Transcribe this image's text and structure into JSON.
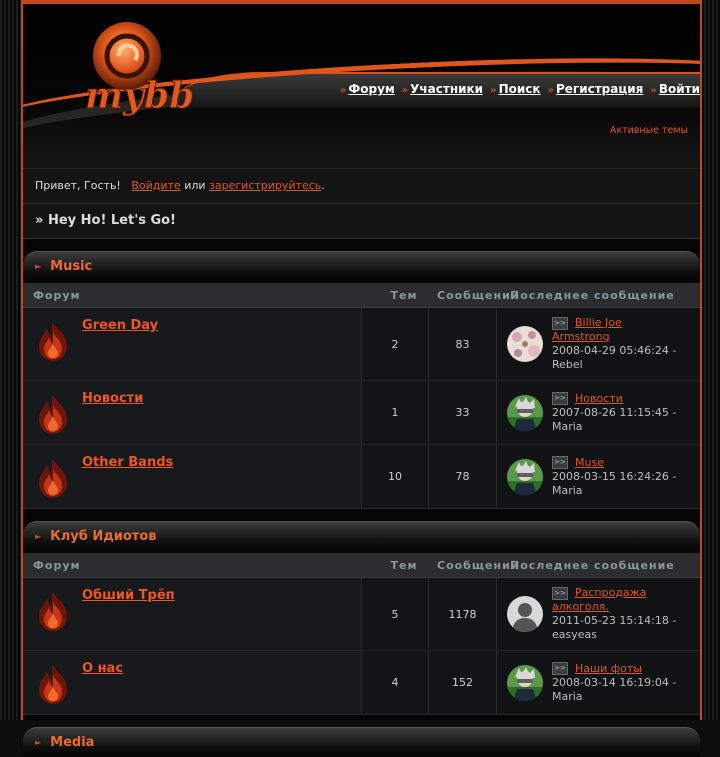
{
  "header": {
    "nav": [
      {
        "label": "Форум",
        "icon": "arrow-icon"
      },
      {
        "label": "Участники",
        "icon": "arrow-icon"
      },
      {
        "label": "Поиск",
        "icon": "arrow-icon"
      },
      {
        "label": "Регистрация",
        "icon": "arrow-icon"
      },
      {
        "label": "Войти",
        "icon": "arrow-icon"
      }
    ],
    "active_topics": "Активные темы",
    "logo_text": "mybb"
  },
  "welcome": {
    "prefix": "Привет, Гость!",
    "login": "Войдите",
    "or": "или",
    "register": "зарегистрируйтесь",
    "end": "."
  },
  "breadcrumb": {
    "sep": "»",
    "title": "Hey Ho! Let's Go!"
  },
  "columns": {
    "forum": "Форум",
    "threads": "Тем",
    "posts": "Сообщений",
    "last": "Последнее сообщение"
  },
  "categories": [
    {
      "name": "Music",
      "forums": [
        {
          "name": "Green Day",
          "threads": "2",
          "posts": "83",
          "last_title": "Billie Joe Armstrong",
          "last_date": "2008-04-29 05:46:24 -",
          "last_user": "Rebel",
          "avatar": "floral"
        },
        {
          "name": "Новости",
          "threads": "1",
          "posts": "33",
          "last_title": "Новости",
          "last_date": "2007-08-26 11:15:45 -",
          "last_user": "Maria",
          "avatar": "ninja"
        },
        {
          "name": "Other Bands",
          "threads": "10",
          "posts": "78",
          "last_title": "Muse",
          "last_date": "2008-03-15 16:24:26 -",
          "last_user": "Maria",
          "avatar": "ninja"
        }
      ]
    },
    {
      "name": "Клуб Идиотов",
      "forums": [
        {
          "name": "Обший Трёп",
          "threads": "5",
          "posts": "1178",
          "last_title": "Распродажа алкоголя.",
          "last_date": "2011-05-23 15:14:18 -",
          "last_user": "easyeas",
          "avatar": "default"
        },
        {
          "name": "О нас",
          "threads": "4",
          "posts": "152",
          "last_title": "Наши фоты",
          "last_date": "2008-03-14 16:19:04 -",
          "last_user": "Maria",
          "avatar": "ninja"
        }
      ]
    },
    {
      "name": "Media",
      "forums": []
    }
  ],
  "colors": {
    "accent": "#e0551e",
    "border": "#c3461c",
    "bg": "#050505"
  }
}
